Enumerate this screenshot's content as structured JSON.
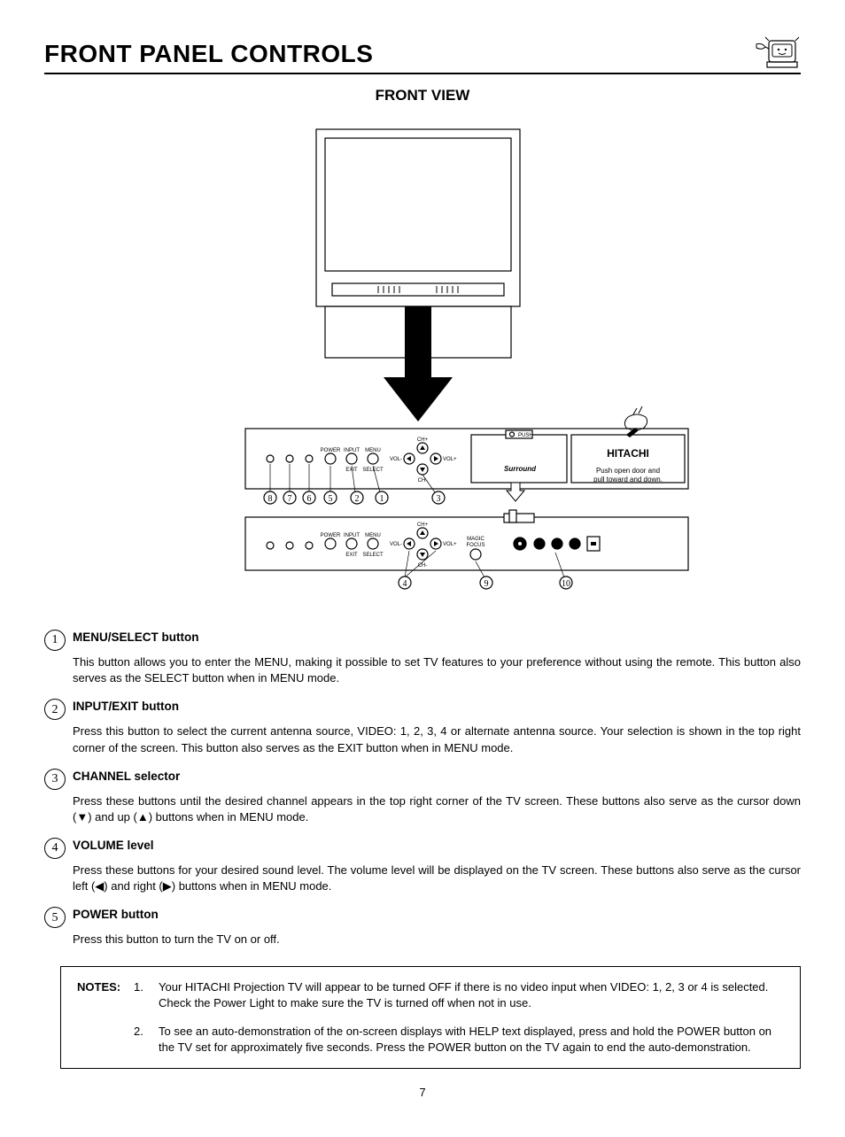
{
  "header": {
    "title": "FRONT PANEL CONTROLS",
    "subtitle": "FRONT VIEW"
  },
  "figure": {
    "brand": "HITACHI",
    "surround": "Surround",
    "push_label": "PUSH",
    "door_instruction_line1": "Push open door and",
    "door_instruction_line2": "pull toward and down.",
    "labels_top": {
      "power": "POWER",
      "input": "INPUT",
      "menu": "MENU",
      "exit": "EXIT",
      "select": "SELECT",
      "ch_up": "CH+",
      "ch_down": "CH-",
      "vol_down": "VOL-",
      "vol_up": "VOL+"
    },
    "labels_bottom": {
      "power": "POWER",
      "input": "INPUT",
      "menu": "MENU",
      "exit": "EXIT",
      "select": "SELECT",
      "ch_up": "CH+",
      "ch_down": "CH-",
      "vol_down": "VOL-",
      "vol_up": "VOL+",
      "magic": "MAGIC",
      "focus": "FOCUS"
    },
    "callouts_row1": [
      "8",
      "7",
      "6",
      "5",
      "2",
      "1",
      "3"
    ],
    "callouts_row2": [
      "4",
      "9",
      "10"
    ]
  },
  "items": [
    {
      "num": "1",
      "head": "MENU/SELECT button",
      "body": "This button allows you to enter the MENU, making it possible to set TV features to your preference without using the remote.  This button also serves as the SELECT button when in MENU mode."
    },
    {
      "num": "2",
      "head": "INPUT/EXIT button",
      "body": "Press this button to select the current antenna source, VIDEO: 1, 2, 3, 4 or alternate antenna source.  Your selection is shown in the top right corner of the screen.  This button also serves as the EXIT button when in MENU mode."
    },
    {
      "num": "3",
      "head": "CHANNEL selector",
      "body": "Press these buttons until the desired channel appears in the top right corner of the TV screen.  These buttons also serve as the cursor down (▼) and up (▲) buttons when in MENU mode."
    },
    {
      "num": "4",
      "head": "VOLUME level",
      "body": "Press these buttons for your desired sound level.  The volume level will be displayed on the TV screen.  These buttons also serve as the cursor left (◀) and right (▶) buttons when in MENU mode."
    },
    {
      "num": "5",
      "head": "POWER button",
      "body": "Press this button to turn the TV on or off."
    }
  ],
  "notes": {
    "label": "NOTES:",
    "entries": [
      {
        "num": "1.",
        "text": "Your HITACHI Projection TV will appear to be turned OFF if there is no video input when VIDEO: 1, 2, 3 or 4 is selected.  Check the Power Light to make sure the TV is turned off when not in use."
      },
      {
        "num": "2.",
        "text": "To see an auto-demonstration of the on-screen displays with HELP text displayed, press and hold the POWER button on the TV set for approximately five seconds.  Press the POWER button on the TV again to end the auto-demonstration."
      }
    ]
  },
  "page_number": "7"
}
